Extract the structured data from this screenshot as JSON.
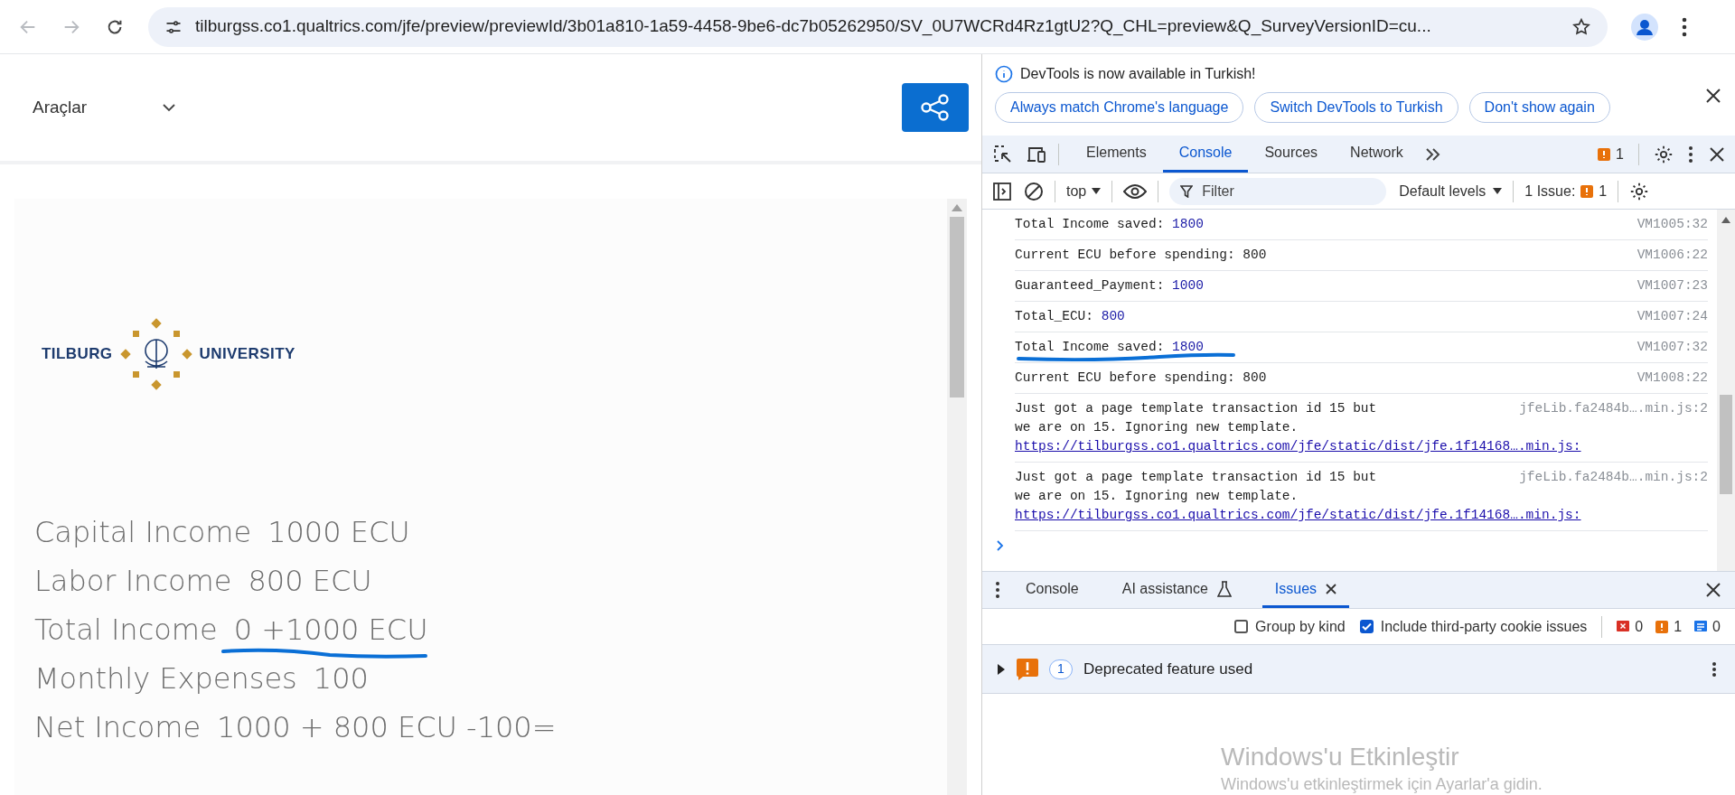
{
  "browser": {
    "url": "tilburgss.co1.qualtrics.com/jfe/preview/previewId/3b01a810-1a59-4458-9be6-dc7b05262950/SV_0U7WCRd4Rz1gtU2?Q_CHL=preview&Q_SurveyVersionID=cu..."
  },
  "survey": {
    "tools_menu": "Araçlar",
    "logo": {
      "left": "TILBURG",
      "right": "UNIVERSITY"
    },
    "lines": [
      {
        "label": "Capital Income",
        "value": "1000 ECU",
        "annotated": false
      },
      {
        "label": "Labor Income",
        "value": "800 ECU",
        "annotated": false
      },
      {
        "label": "Total Income",
        "value": "0 +1000 ECU",
        "annotated": true
      },
      {
        "label": "Monthly Expenses",
        "value": "100",
        "annotated": false
      },
      {
        "label": "Net Income",
        "value": "1000 + 800 ECU -100=",
        "annotated": false
      }
    ]
  },
  "devtools": {
    "infobar": {
      "message": "DevTools is now available in Turkish!",
      "buttons": [
        "Always match Chrome's language",
        "Switch DevTools to Turkish",
        "Don't show again"
      ]
    },
    "tabs": [
      {
        "label": "Elements",
        "selected": false
      },
      {
        "label": "Console",
        "selected": true
      },
      {
        "label": "Sources",
        "selected": false
      },
      {
        "label": "Network",
        "selected": false
      }
    ],
    "issue_badge": "1",
    "toolbar": {
      "context": "top",
      "filter_placeholder": "Filter",
      "levels": "Default levels",
      "issues_label": "1 Issue:",
      "issues_count": "1"
    },
    "messages": [
      {
        "kind": "number",
        "label": "Total Income saved:",
        "value": "1800",
        "source": "VM1005:32",
        "annotated": false
      },
      {
        "kind": "string",
        "label": "Current ECU before spending: 800",
        "source": "VM1006:22",
        "annotated": false
      },
      {
        "kind": "number",
        "label": "Guaranteed_Payment:",
        "value": "1000",
        "source": "VM1007:23",
        "annotated": false
      },
      {
        "kind": "number",
        "label": "Total_ECU:",
        "value": "800",
        "source": "VM1007:24",
        "annotated": false
      },
      {
        "kind": "number",
        "label": "Total Income saved:",
        "value": "1800",
        "source": "VM1007:32",
        "annotated": true
      },
      {
        "kind": "string",
        "label": "Current ECU before spending: 800",
        "source": "VM1008:22",
        "annotated": false
      },
      {
        "kind": "link",
        "label": "Just got a page template transaction id 15 but we are on 15. Ignoring new template.",
        "link": "https://tilburgss.co1.qualtrics.com/jfe/static/dist/jfe.1f14168….min.js:",
        "source": "jfeLib.fa2484b….min.js:2",
        "annotated": false
      },
      {
        "kind": "link",
        "label": "Just got a page template transaction id 15 but we are on 15. Ignoring new template.",
        "link": "https://tilburgss.co1.qualtrics.com/jfe/static/dist/jfe.1f14168….min.js:",
        "source": "jfeLib.fa2484b….min.js:2",
        "annotated": false
      }
    ],
    "drawer": {
      "tabs": [
        {
          "label": "Console",
          "selected": false,
          "closable": false
        },
        {
          "label": "AI assistance",
          "selected": false,
          "closable": false
        },
        {
          "label": "Issues",
          "selected": true,
          "closable": true
        }
      ],
      "options": [
        {
          "label": "Group by kind",
          "checked": false
        },
        {
          "label": "Include third-party cookie issues",
          "checked": true
        }
      ],
      "counts": {
        "errors": "0",
        "warnings": "1",
        "infos": "0"
      },
      "issues": [
        {
          "count": "1",
          "title": "Deprecated feature used",
          "expanded": false
        }
      ]
    }
  },
  "os_notice": {
    "title": "Windows'u Etkinleştir",
    "subtitle": "Windows'u etkinleştirmek için Ayarlar'a gidin."
  }
}
